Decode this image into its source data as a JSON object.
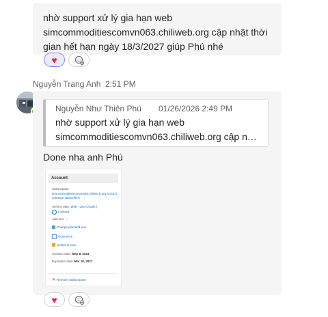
{
  "message1": {
    "text": "nhờ support xử lý gia hạn web simcommoditiescomvn063.chiliweb.org cập nhật thời gian hết hạn ngày 18/3/2027 giúp Phú nhé"
  },
  "reactions1": {
    "emoji": "♥",
    "add_reaction_icon": "add-reaction"
  },
  "message2": {
    "sender": "Nguyễn Trang Anh",
    "time": "2:51 PM",
    "quote": {
      "author": "Nguyễn Như Thiên Phú",
      "timestamp": "01/26/2026 2:49 PM",
      "line1": "nhờ support xử lý gia hạn web",
      "line2": "simcommoditiescomvn063.chiliweb.org cập nhậ..."
    },
    "text": "Done nha anh Phú",
    "screenshot": {
      "header": "Account",
      "subscription_label": "Subscription",
      "subscription_value": "simcommoditiescomvn063.chiliwe b.org (CHILI) (Change subscriber)",
      "service_plan_label": "Service plan:",
      "service_plan_value": "Web - Linu Chuẩn (",
      "service_plan_locked": "Locked)",
      "addons_label": "Add-ons: —",
      "change_plan": "Change plan/add-ons",
      "customize": "Customize",
      "unlock_sync": "Unlock & sync",
      "creation_label": "Creation date:",
      "creation_value": "May 8, 2023",
      "expiration_label": "Expiration date:",
      "expiration_value": "Mar 18, 2027",
      "remove": "Remove Subscription"
    }
  },
  "reactions2": {
    "emoji": "♥",
    "add_reaction_icon": "add-reaction"
  }
}
